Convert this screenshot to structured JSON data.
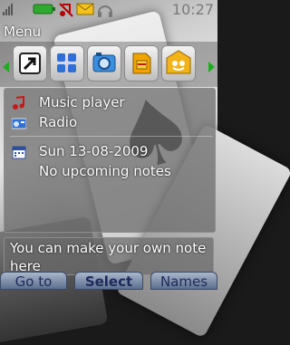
{
  "status": {
    "time": "10:27",
    "icons": [
      "signal-icon",
      "battery-icon",
      "no-audio-icon",
      "message-icon",
      "headset-icon"
    ]
  },
  "title": "Menu",
  "tabs": [
    {
      "icon": "shortcut-icon"
    },
    {
      "icon": "applications-icon"
    },
    {
      "icon": "camera-icon"
    },
    {
      "icon": "sim-card-icon"
    },
    {
      "icon": "messaging-icon"
    }
  ],
  "panel": {
    "music": "Music player",
    "radio": "Radio",
    "date": "Sun 13-08-2009",
    "notes": "No upcoming notes"
  },
  "note": "You can make your own note here",
  "softkeys": {
    "left": "Go to",
    "center": "Select",
    "right": "Names"
  },
  "colors": {
    "accent_green": "#1faa1f",
    "softkey_text": "#1e2a58"
  }
}
